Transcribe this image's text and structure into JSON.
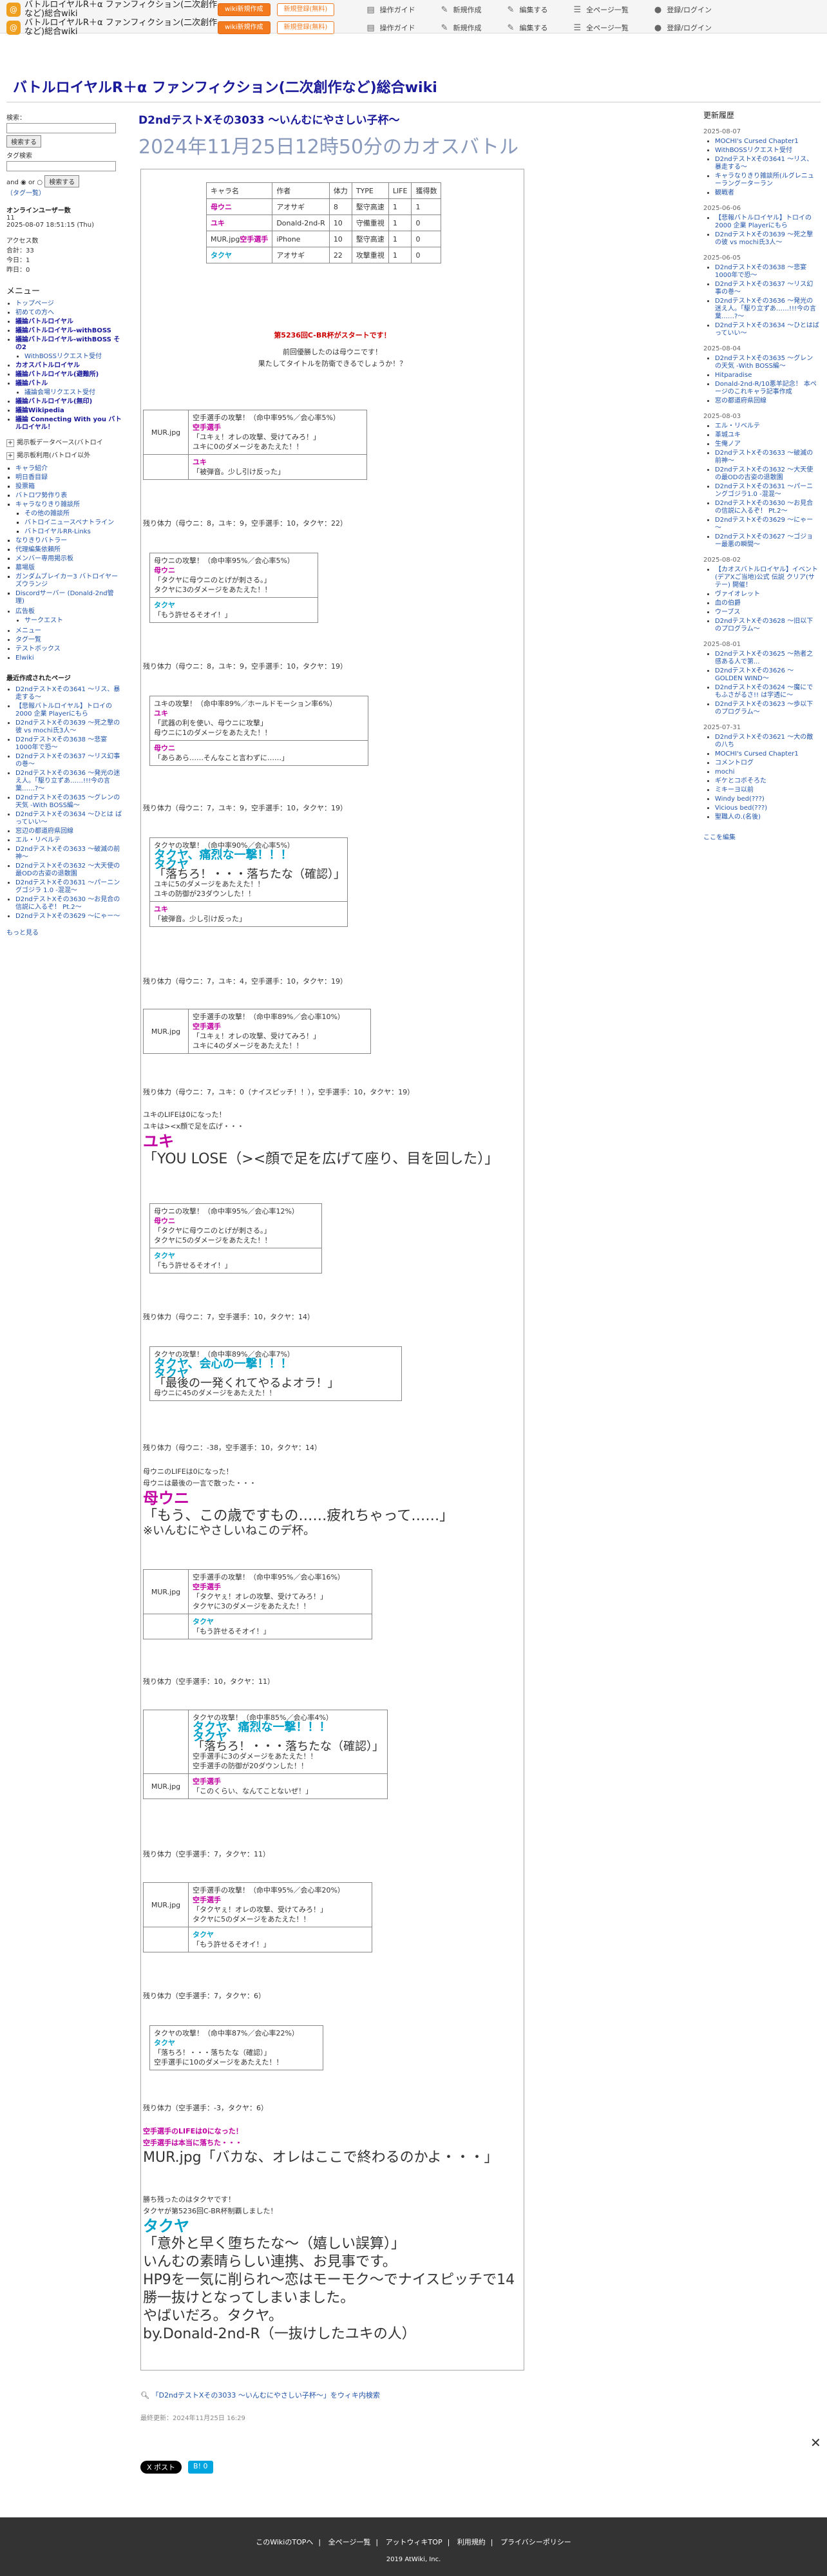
{
  "topbar": {
    "title": "バトルロイヤルR＋α ファンフィクション(二次創作など)総合wiki",
    "wiki_new": "wiki新規作成",
    "login_pro": "新規登録(無料)",
    "guide": "操作ガイド",
    "new_create": "新規作成",
    "edit": "編集する",
    "all_pages": "全ページ一覧",
    "login": "登録/ログイン"
  },
  "site_title": "バトルロイヤルR＋α ファンフィクション(二次創作など)総合wiki",
  "page": {
    "h1": "D2ndテストXその3033 ～いんむにやさしい子杯～",
    "date": "2024年11月25日12時50分のカオスバトル"
  },
  "stat_table": {
    "headers": [
      "キャラ名",
      "作者",
      "体力",
      "TYPE",
      "LIFE",
      "獲得数"
    ],
    "rows": [
      [
        "母ウニ",
        "アオサギ",
        "8",
        "堅守高速",
        "1",
        "1"
      ],
      [
        "ユキ",
        "Donald-2nd-R",
        "10",
        "守備重視",
        "1",
        "0"
      ],
      [
        "空手選手",
        "iPhone",
        "10",
        "堅守高速",
        "1",
        "0"
      ],
      [
        "タクヤ",
        "アオサギ",
        "22",
        "攻撃重視",
        "1",
        "0"
      ]
    ],
    "img_alt": "MUR.jpg"
  },
  "intro": {
    "line1": "第5236回C-BR杯がスタートです！",
    "line2": "前回優勝したのは母ウニです！",
    "line3": "果たしてタイトルを防衛できるでしょうか！？"
  },
  "battle": {
    "t1_head": "空手選手の攻撃！（命中率95%／会心率5%）",
    "t1_name": "空手選手",
    "t1_line": "「ユキぇ！オレの攻撃、受けてみろ！」",
    "t1_dmg": "ユキに0のダメージをあたえた！！",
    "t1_r_name": "ユキ",
    "t1_r_line": "「被弾音。少し引け反った」",
    "hp1": "残り体力（母ウニ：8，ユキ：9，空手選手：10，タクヤ：22）",
    "t2_head": "母ウニの攻撃！（命中率95%／会心率5%）",
    "t2_name": "母ウニ",
    "t2_line": "「タクヤに母ウニのとげが刺さる。」",
    "t2_dmg": "タクヤに3のダメージをあたえた！！",
    "t2_r_name": "タクヤ",
    "t2_r_line": "「もう許せるそオイ！」",
    "hp2": "残り体力（母ウニ：8，ユキ：9，空手選手：10，タクヤ：19）",
    "t3_head": "ユキの攻撃！（命中率89%／ホールドモーション率6%）",
    "t3_name": "ユキ",
    "t3_line": "「武器の利を使い、母ウニに攻撃」",
    "t3_dmg": "母ウニに1のダメージをあたえた！！",
    "t3_r_name": "母ウニ",
    "t3_r_line": "「あらあら……そんなこと言わずに……」",
    "hp3": "残り体力（母ウニ：7，ユキ：9，空手選手：10，タクヤ：19）",
    "t4_head": "タクヤの攻撃！（命中率90%／会心率5%）",
    "t4_crit": "タクヤ、痛烈な一撃！！！",
    "t4_name": "タクヤ",
    "t4_line": "「落ちろ！・・・落ちたな（確認）」",
    "t4_dmg": "ユキに5のダメージをあたえた！！",
    "t4_down": "ユキの防御が23ダウンした！！",
    "t4_r_name": "ユキ",
    "t4_r_line": "「被弾音。少し引け反った」",
    "hp4": "残り体力（母ウニ：7，ユキ：4，空手選手：10，タクヤ：19）",
    "t5_head": "空手選手の攻撃！（命中率89%／会心率10%）",
    "t5_name": "空手選手",
    "t5_line": "「ユキぇ！オレの攻撃、受けてみろ！」",
    "t5_dmg": "ユキに4のダメージをあたえた！！",
    "hp5": "残り体力（母ウニ：7，ユキ：0（ナイスピッチ！！），空手選手：10，タクヤ：19）",
    "k1a": "ユキのLIFEは0になった！",
    "k1b": "ユキは><x顔で足を広げ・・・",
    "k1_name": "ユキ",
    "k1_line": "「YOU LOSE（><顔で足を広げて座り、目を回した）」",
    "t6_head": "母ウニの攻撃！（命中率95%／会心率12%）",
    "t6_name": "母ウニ",
    "t6_line": "「タクヤに母ウニのとげが刺さる。」",
    "t6_dmg": "タクヤに5のダメージをあたえた！！",
    "t6_r_name": "タクヤ",
    "t6_r_line": "「もう許せるそオイ！」",
    "hp6": "残り体力（母ウニ：7，空手選手：10，タクヤ：14）",
    "t7_head": "タクヤの攻撃！（命中率89%／会心率7%）",
    "t7_crit": "タクヤ、会心の一撃！！！",
    "t7_name": "タクヤ",
    "t7_line": "「最後の一発くれてやるよオラ！」",
    "t7_dmg": "母ウニに45のダメージをあたえた！！",
    "hp7": "残り体力（母ウニ：-38，空手選手：10，タクヤ：14）",
    "k2a": "母ウニのLIFEは0になった！",
    "k2b": "母ウニは最後の一言で散った・・・",
    "k2_name": "母ウニ",
    "k2_line": "「もう、この歳ですもの……疲れちゃって……」",
    "k2_note": "※いんむにやさしいねこのデ杯。",
    "t8_head": "空手選手の攻撃！（命中率95%／会心率16%）",
    "t8_name": "空手選手",
    "t8_line": "「タクヤぇ！オレの攻撃、受けてみろ！」",
    "t8_dmg": "タクヤに3のダメージをあたえた！！",
    "t8_r_name": "タクヤ",
    "t8_r_line": "「もう許せるそオイ！」",
    "hp8": "残り体力（空手選手：10，タクヤ：11）",
    "t9_head": "タクヤの攻撃！（命中率85%／会心率4%）",
    "t9_crit": "タクヤ、痛烈な一撃！！！",
    "t9_name": "タクヤ",
    "t9_line": "「落ちろ！・・・落ちたな（確認）」",
    "t9_dmg": "空手選手に3のダメージをあたえた！！",
    "t9_down": "空手選手の防御が20ダウンした！！",
    "t9_r_name": "空手選手",
    "t9_r_line": "「このくらい、なんてことないぜ！」",
    "hp9": "残り体力（空手選手：7，タクヤ：11）",
    "t10_head": "空手選手の攻撃！（命中率95%／会心率20%）",
    "t10_name": "空手選手",
    "t10_line": "「タクヤぇ！オレの攻撃、受けてみろ！」",
    "t10_dmg": "タクヤに5のダメージをあたえた！！",
    "t10_r_name": "タクヤ",
    "t10_r_line": "「もう許せるそオイ！」",
    "hp10": "残り体力（空手選手：7，タクヤ：6）",
    "t11_head": "タクヤの攻撃！（命中率87%／会心率22%）",
    "t11_name": "タクヤ",
    "t11_line": "「落ちろ！・・・落ちたな（確認）」",
    "t11_dmg": "空手選手に10のダメージをあたえた！！",
    "hp11": "残り体力（空手選手：-3，タクヤ：6）",
    "k3a": "空手選手のLIFEは0になった！",
    "k3b": "空手選手は本当に落ちた・・・",
    "k3_img": "MUR.jpg",
    "k3_line": "「バカな、オレはここで終わるのかよ・・・」",
    "win1": "勝ち残ったのはタクヤです！",
    "win2": "タクヤが第5236回C-BR杯制覇しました！",
    "win_name": "タクヤ",
    "win_line": "「意外と早く堕ちたな～（嬉しい誤算）」",
    "end1": "いんむの素晴らしい連携、お見事です。",
    "end2": "HP9を一気に削られ～恋はモーモク～でナイスピッチで14勝一抜けとなってしまいました。",
    "end3": "やばいだろ。タクヤ。",
    "end4": "by.Donald-2nd-R（一抜けしたユキの人）"
  },
  "leftnav": {
    "search_label": "検索：",
    "search_btn": "検索する",
    "tag_label": "タグ検索",
    "and": "and",
    "or": "or",
    "tag_btn": "検索する",
    "tag_list": "（タグ一覧）",
    "online_label": "オンラインユーザー数",
    "online_count": "11",
    "online_time": "2025-08-07 18:51:15 (Thu)",
    "pv_label": "アクセス数",
    "pv_total": "合計：33",
    "pv_today": "今日：1",
    "pv_yesterday": "昨日：0",
    "menu_title": "メニュー",
    "menu": [
      "トップページ",
      "初めての方へ",
      "議論バトルロイヤル",
      "議論バトルロイヤル-withBOSS",
      "議論バトルロイヤル-withBOSS その2",
      "WithBOSSリクエスト受付",
      "カオスバトルロイヤル",
      "議論バトルロイヤル(避難所)",
      "議論バトル",
      "議論会場リクエスト受付",
      "議論バトルロイヤル(無印)",
      "議論Wikipedia",
      "議論 Connecting With you バトルロイヤル！"
    ],
    "tree1": "掲示板データベース(バトロイ",
    "tree2": "掲示板利用(バトロイ以外",
    "sub_menu": [
      "キャラ紹介",
      "明日香目録",
      "投票箱",
      "バトロワ勢作り表",
      "キャラなりきり雑談所",
      "その他の雑談所",
      "バトロイニュースペナトライン",
      "バトロイヤルRR-Links",
      "なりきりバトラー",
      "代理編集依頼所",
      "メンバー専用掲示板",
      "墓場版",
      "ガンダムブレイカー3 バトロイヤーズウランジ",
      "Discordサーバー (Donald-2nd管理)"
    ],
    "other_title": "広告板",
    "other": [
      "サークエスト"
    ],
    "links": [
      "メニュー",
      "タグ一覧",
      "テストボックス",
      "Elwiki"
    ],
    "recent_title": "最近作成されたページ",
    "recent": [
      "D2ndテストXその3641 ～リス、暴走する～",
      "【悲報バトルロイヤル】トロイの2000 企業 Playerにもら",
      "D2ndテストXその3639 ～死之撃の彼 vs mochi氏3人～",
      "D2ndテストXその3638 ～悲宴1000年で恐～",
      "D2ndテストXその3637 ～リス幻事の巻～",
      "D2ndテストXその3636 ～発光の迷え人。「駆り立ずあ……!!!今の言葉……?～",
      "D2ndテストXその3635 ～グレンの天気 -With BOSS編～",
      "D2ndテストXその3634 ～ひとは ばっていい～",
      "窓辺の都道府県回線",
      "エル・リベルテ",
      "D2ndテストXその3633 ～破滅の前神～",
      "D2ndテストXその3632 ～大天使の最ODの古姿の退散園",
      "D2ndテストXその3631 ～パーニングゴジラ 1.0 -混混～",
      "D2ndテストXその3630 ～お見合の信説に入るぞ！ Pt.2～",
      "D2ndテストXその3629 ～にゃー～"
    ],
    "more": "もっと見る"
  },
  "rightnav": {
    "title": "更新履歴",
    "groups": [
      {
        "date": "2025-08-07",
        "items": [
          "MOCHI's Cursed Chapter1",
          "WithBOSSリクエスト受付",
          "D2ndテストXその3641 ～リス、暴走する～",
          "キャラなりきり雑談所(ルグレニューラングーターラン",
          "観戦者"
        ]
      },
      {
        "date": "2025-06-06",
        "items": [
          "【悲報バトルロイヤル】トロイの2000 企業 Playerにもら",
          "D2ndテストXその3639 ～死之撃の彼 vs mochi氏3人～"
        ]
      },
      {
        "date": "2025-06-05",
        "items": [
          "D2ndテストXその3638 ～悲宴1000年で恐～",
          "D2ndテストXその3637 ～リス幻事の巻～",
          "D2ndテストXその3636 ～発光の迷え人。「駆り立ずあ……!!!今の言葉……?～",
          "D2ndテストXその3634 ～ひとはばっていい～"
        ]
      },
      {
        "date": "2025-08-04",
        "items": [
          "D2ndテストXその3635 ～グレンの天気 -With BOSS編～",
          "Hitparadise",
          "Donald-2nd-R/10悪羊記念！ 本ページのこれキャラ記事作成",
          "窓の都道府県回線"
        ]
      },
      {
        "date": "2025-08-03",
        "items": [
          "エル・リベルテ",
          "革城ユキ",
          "生俺ノア",
          "D2ndテストXその3633 ～破滅の前神～",
          "D2ndテストXその3632 ～大天使の最ODの古姿の退散園",
          "D2ndテストXその3631 ～パーニングゴジラ1.0 -混混～",
          "D2ndテストXその3630 ～お見合の信説に入るぞ！ Pt.2～",
          "D2ndテストXその3629 ～にゃー～",
          "D2ndテストXその3627 ～ゴジョー最悪の瞬間～"
        ]
      },
      {
        "date": "2025-08-02",
        "items": [
          "【カオスバトルロイヤル】イベント(デアXご当地)公式 伝説 クリア(サテー) 開催！",
          "ヴァイオレット",
          "血の伯爵",
          "ウーブス",
          "D2ndテストXその3628 ～旧以下のプログラム～"
        ]
      },
      {
        "date": "2025-08-01",
        "items": [
          "D2ndテストXその3625 ～熱者之感ある人で第...",
          "D2ndテストXその3626 ～ GOLDEN WIND～",
          "D2ndテストXその3624 ～魔にでもふさがるさ!! は字透に～",
          "D2ndテストXその3623 ～歩以下のプログラム～"
        ]
      },
      {
        "date": "2025-07-31",
        "items": [
          "D2ndテストXその3621 ～大の敵の八ち",
          "MOCHI's Cursed Chapter1",
          "コメントログ",
          "mochi",
          "ギケとコボそろた",
          "ミキーヨ以前",
          "Windy bed(???)",
          "Vicious bed(???)",
          "聖職人の.(名後)"
        ]
      }
    ],
    "edit": "ここを編集"
  },
  "footer_area": {
    "wiki_link": "「D2ndテストXその3033 ～いんむにやさしい子杯～」をウィキ内検索",
    "last_update": "最終更新：2024年11月25日 16:29",
    "post": "X ポスト",
    "hatena": "B! 0"
  },
  "footer": {
    "nav": [
      "このWikiのTOPへ",
      "全ページ一覧",
      "アットウィキTOP",
      "利用規約",
      "プライバシーポリシー"
    ],
    "copyright": "2019 AtWiki, Inc."
  }
}
